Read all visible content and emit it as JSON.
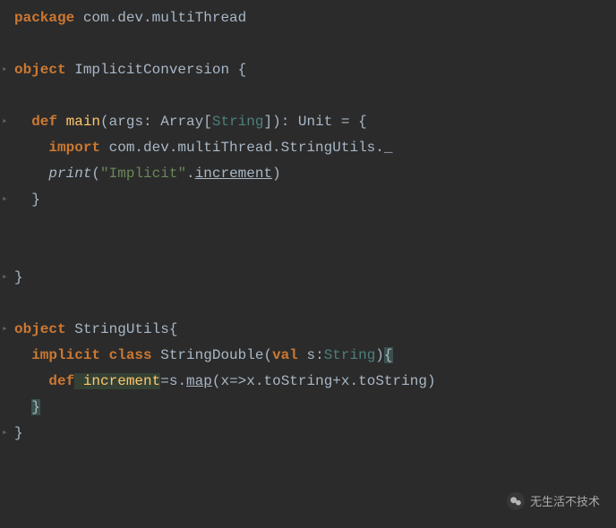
{
  "code": {
    "l1_package": "package",
    "l1_pkgname": " com.dev.multiThread",
    "l3_object": "object",
    "l3_name": " ImplicitConversion ",
    "l3_brace": "{",
    "l5_def": "def",
    "l5_main": " main",
    "l5_open": "(",
    "l5_args": "args",
    "l5_colon1": ": ",
    "l5_array": "Array",
    "l5_bracket_open": "[",
    "l5_string": "String",
    "l5_bracket_close": "]",
    "l5_close": ")",
    "l5_colon2": ": ",
    "l5_unit": "Unit",
    "l5_eq": " = {",
    "l6_import": "import",
    "l6_path": " com.dev.multiThread.StringUtils._",
    "l7_print": "print",
    "l7_open": "(",
    "l7_str": "\"Implicit\"",
    "l7_dot": ".",
    "l7_incr": "increment",
    "l7_close": ")",
    "l8_brace": "}",
    "l11_brace": "}",
    "l13_object": "object",
    "l13_name": " StringUtils",
    "l13_brace": "{",
    "l14_implicit": "implicit",
    "l14_class": " class",
    "l14_name": " StringDouble",
    "l14_open": "(",
    "l14_val": "val",
    "l14_param": " s",
    "l14_colon": ":",
    "l14_type": "String",
    "l14_close": ")",
    "l14_brace": "{",
    "l15_def": "def",
    "l15_name": " increment",
    "l15_eq": "=s.",
    "l15_map": "map",
    "l15_open": "(",
    "l15_x1": "x",
    "l15_arrow": "=>",
    "l15_x2": "x",
    "l15_tos1": ".toString+",
    "l15_x3": "x",
    "l15_tos2": ".toString",
    "l15_close": ")",
    "l16_brace": "}",
    "l17_brace": "}"
  },
  "watermark": {
    "text": "无生活不技术"
  }
}
